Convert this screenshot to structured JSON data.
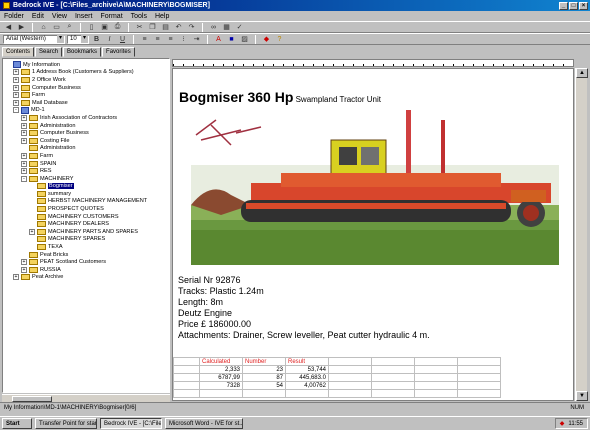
{
  "window": {
    "title": "Bedrock IVE - [C:\\Files_archive\\A\\MACHINERY\\BOGMISER]"
  },
  "menu": [
    "Folder",
    "Edit",
    "View",
    "Insert",
    "Format",
    "Tools",
    "Help"
  ],
  "toolbar": {
    "font_name": "Arial (Western)",
    "font_size": "10"
  },
  "left_tabs": [
    "Contents",
    "Search",
    "Bookmarks",
    "Favorites"
  ],
  "tree": [
    {
      "label": "My Information",
      "depth": 0,
      "pm": "",
      "icon": "book"
    },
    {
      "label": "1 Address Book (Customers & Suppliers)",
      "depth": 1,
      "pm": "+",
      "icon": "folder"
    },
    {
      "label": "2 Office Work",
      "depth": 1,
      "pm": "+",
      "icon": "folder"
    },
    {
      "label": "Computer Business",
      "depth": 1,
      "pm": "+",
      "icon": "folder"
    },
    {
      "label": "Farm",
      "depth": 1,
      "pm": "+",
      "icon": "folder"
    },
    {
      "label": "Mail Database",
      "depth": 1,
      "pm": "+",
      "icon": "folder"
    },
    {
      "label": "MD-1",
      "depth": 1,
      "pm": "-",
      "icon": "book"
    },
    {
      "label": "Irish Association of Contractors",
      "depth": 2,
      "pm": "+",
      "icon": "folder"
    },
    {
      "label": "Administration",
      "depth": 2,
      "pm": "+",
      "icon": "folder"
    },
    {
      "label": "Computer Business",
      "depth": 2,
      "pm": "+",
      "icon": "folder"
    },
    {
      "label": "Costing File",
      "depth": 2,
      "pm": "+",
      "icon": "folder"
    },
    {
      "label": "Administration",
      "depth": 2,
      "pm": "",
      "icon": "folder"
    },
    {
      "label": "Farm",
      "depth": 2,
      "pm": "+",
      "icon": "folder"
    },
    {
      "label": "SPAIN",
      "depth": 2,
      "pm": "+",
      "icon": "folder"
    },
    {
      "label": "RES",
      "depth": 2,
      "pm": "+",
      "icon": "folder"
    },
    {
      "label": "MACHINERY",
      "depth": 2,
      "pm": "-",
      "icon": "folder"
    },
    {
      "label": "Bogmiser",
      "depth": 3,
      "pm": "",
      "icon": "folder",
      "selected": true
    },
    {
      "label": "summary",
      "depth": 3,
      "pm": "",
      "icon": "folder"
    },
    {
      "label": "HERBST MACHINERY MANAGEMENT",
      "depth": 3,
      "pm": "",
      "icon": "folder"
    },
    {
      "label": "PROSPECT QUOTES",
      "depth": 3,
      "pm": "",
      "icon": "folder"
    },
    {
      "label": "MACHINERY CUSTOMERS",
      "depth": 3,
      "pm": "",
      "icon": "folder"
    },
    {
      "label": "MACHINERY DEALERS",
      "depth": 3,
      "pm": "",
      "icon": "folder"
    },
    {
      "label": "MACHINERY PARTS AND SPARES",
      "depth": 3,
      "pm": "+",
      "icon": "folder"
    },
    {
      "label": "MACHINERY SPARES",
      "depth": 3,
      "pm": "",
      "icon": "folder"
    },
    {
      "label": "TEXA",
      "depth": 3,
      "pm": "",
      "icon": "folder"
    },
    {
      "label": "Peat Bricks",
      "depth": 2,
      "pm": "",
      "icon": "folder"
    },
    {
      "label": "PEAT Scotland Customers",
      "depth": 2,
      "pm": "+",
      "icon": "folder"
    },
    {
      "label": "RUSSIA",
      "depth": 2,
      "pm": "+",
      "icon": "folder"
    },
    {
      "label": "Peat Archive",
      "depth": 1,
      "pm": "+",
      "icon": "folder"
    }
  ],
  "document": {
    "title_main": "Bogmiser  360 Hp",
    "title_sub": " Swampland  Tractor Unit",
    "specs": [
      "Serial Nr 92876",
      "Tracks: Plastic   1.24m",
      "Length: 8m",
      "Deutz Engine",
      "Price £  186000.00",
      "Attachments: Drainer, Screw leveller, Peat cutter hydraulic 4 m."
    ],
    "table": {
      "headers": [
        "",
        "Calculated",
        "Number",
        "Result",
        "",
        "",
        "",
        ""
      ],
      "rows": [
        [
          "",
          "2,333",
          "23",
          "53,744",
          "",
          "",
          "",
          ""
        ],
        [
          "",
          "6787,99",
          "87",
          "445,683.0",
          "",
          "",
          "",
          ""
        ],
        [
          "",
          "7328",
          "54",
          "4,00762",
          "",
          "",
          "",
          ""
        ],
        [
          "",
          "",
          "",
          "",
          "",
          "",
          "",
          ""
        ]
      ]
    }
  },
  "status": {
    "path": "My Information\\MD-1\\MACHINERY\\Bogmiser[0/6]",
    "right": "NUM"
  },
  "taskbar": {
    "start": "Start",
    "items": [
      "Transfer Point for start on",
      "Bedrock IVE - [C:\\Files...",
      "Microsoft Word - IVE for st..."
    ],
    "time": "11:55"
  },
  "colors": {
    "titlebar": "#00107a",
    "selection": "#000080",
    "table_header_text": "#e02020"
  }
}
